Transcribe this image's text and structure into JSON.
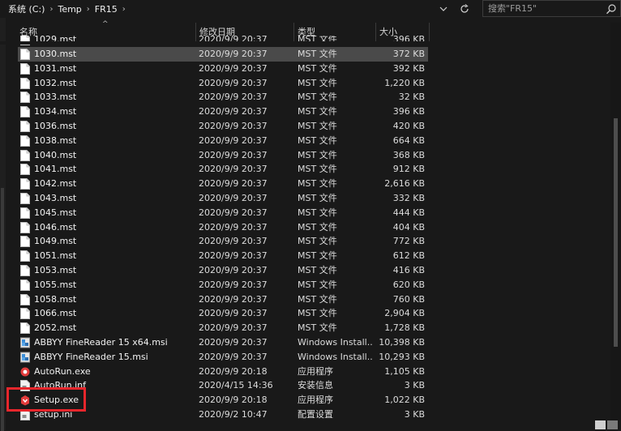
{
  "breadcrumb": {
    "items": [
      "系统 (C:)",
      "Temp",
      "FR15"
    ],
    "separator": "›"
  },
  "search": {
    "placeholder": "搜索\"FR15\""
  },
  "columns": {
    "name": "名称",
    "date": "修改日期",
    "type": "类型",
    "size": "大小"
  },
  "partial_top_row": {
    "name": "1029.mst",
    "date": "2020/9/9 20:37",
    "type": "MST 文件",
    "size": "396 KB"
  },
  "files": [
    {
      "name": "1030.mst",
      "date": "2020/9/9 20:37",
      "type": "MST 文件",
      "size": "372 KB",
      "icon": "file-icon",
      "selected": true
    },
    {
      "name": "1031.mst",
      "date": "2020/9/9 20:37",
      "type": "MST 文件",
      "size": "392 KB",
      "icon": "file-icon"
    },
    {
      "name": "1032.mst",
      "date": "2020/9/9 20:37",
      "type": "MST 文件",
      "size": "1,220 KB",
      "icon": "file-icon"
    },
    {
      "name": "1033.mst",
      "date": "2020/9/9 20:37",
      "type": "MST 文件",
      "size": "32 KB",
      "icon": "file-icon"
    },
    {
      "name": "1034.mst",
      "date": "2020/9/9 20:37",
      "type": "MST 文件",
      "size": "396 KB",
      "icon": "file-icon"
    },
    {
      "name": "1036.mst",
      "date": "2020/9/9 20:37",
      "type": "MST 文件",
      "size": "420 KB",
      "icon": "file-icon"
    },
    {
      "name": "1038.mst",
      "date": "2020/9/9 20:37",
      "type": "MST 文件",
      "size": "664 KB",
      "icon": "file-icon"
    },
    {
      "name": "1040.mst",
      "date": "2020/9/9 20:37",
      "type": "MST 文件",
      "size": "368 KB",
      "icon": "file-icon"
    },
    {
      "name": "1041.mst",
      "date": "2020/9/9 20:37",
      "type": "MST 文件",
      "size": "912 KB",
      "icon": "file-icon"
    },
    {
      "name": "1042.mst",
      "date": "2020/9/9 20:37",
      "type": "MST 文件",
      "size": "2,616 KB",
      "icon": "file-icon"
    },
    {
      "name": "1043.mst",
      "date": "2020/9/9 20:37",
      "type": "MST 文件",
      "size": "332 KB",
      "icon": "file-icon"
    },
    {
      "name": "1045.mst",
      "date": "2020/9/9 20:37",
      "type": "MST 文件",
      "size": "444 KB",
      "icon": "file-icon"
    },
    {
      "name": "1046.mst",
      "date": "2020/9/9 20:37",
      "type": "MST 文件",
      "size": "404 KB",
      "icon": "file-icon"
    },
    {
      "name": "1049.mst",
      "date": "2020/9/9 20:37",
      "type": "MST 文件",
      "size": "772 KB",
      "icon": "file-icon"
    },
    {
      "name": "1051.mst",
      "date": "2020/9/9 20:37",
      "type": "MST 文件",
      "size": "612 KB",
      "icon": "file-icon"
    },
    {
      "name": "1053.mst",
      "date": "2020/9/9 20:37",
      "type": "MST 文件",
      "size": "416 KB",
      "icon": "file-icon"
    },
    {
      "name": "1055.mst",
      "date": "2020/9/9 20:37",
      "type": "MST 文件",
      "size": "620 KB",
      "icon": "file-icon"
    },
    {
      "name": "1058.mst",
      "date": "2020/9/9 20:37",
      "type": "MST 文件",
      "size": "760 KB",
      "icon": "file-icon"
    },
    {
      "name": "1066.mst",
      "date": "2020/9/9 20:37",
      "type": "MST 文件",
      "size": "2,904 KB",
      "icon": "file-icon"
    },
    {
      "name": "2052.mst",
      "date": "2020/9/9 20:37",
      "type": "MST 文件",
      "size": "1,728 KB",
      "icon": "file-icon"
    },
    {
      "name": "ABBYY FineReader 15 x64.msi",
      "date": "2020/9/9 20:37",
      "type": "Windows Install...",
      "size": "10,398 KB",
      "icon": "installer-icon"
    },
    {
      "name": "ABBYY FineReader 15.msi",
      "date": "2020/9/9 20:37",
      "type": "Windows Install...",
      "size": "10,293 KB",
      "icon": "installer-icon"
    },
    {
      "name": "AutoRun.exe",
      "date": "2020/9/9 20:18",
      "type": "应用程序",
      "size": "1,105 KB",
      "icon": "autorun-icon"
    },
    {
      "name": "AutoRun.inf",
      "date": "2020/4/15 14:36",
      "type": "安装信息",
      "size": "3 KB",
      "icon": "settings-file-icon"
    },
    {
      "name": "Setup.exe",
      "date": "2020/9/9 20:18",
      "type": "应用程序",
      "size": "1,022 KB",
      "icon": "setup-icon"
    },
    {
      "name": "setup.ini",
      "date": "2020/9/2 10:47",
      "type": "配置设置",
      "size": "3 KB",
      "icon": "settings-file-icon"
    }
  ],
  "colors": {
    "background": "#191919",
    "selected_row": "#4a4a4a",
    "highlight_box": "#e8262c",
    "text": "#e6e6e6"
  },
  "icons": {
    "back": "chevron-down-icon",
    "refresh": "refresh-icon",
    "search": "search-icon"
  }
}
